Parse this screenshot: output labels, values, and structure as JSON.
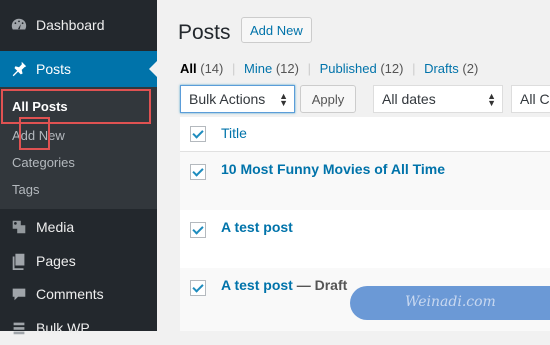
{
  "sidebar": {
    "items": [
      {
        "label": "Dashboard",
        "icon": "dashboard-icon"
      },
      {
        "label": "Posts",
        "icon": "pin-icon"
      },
      {
        "label": "Media",
        "icon": "media-icon"
      },
      {
        "label": "Pages",
        "icon": "pages-icon"
      },
      {
        "label": "Comments",
        "icon": "comments-icon"
      },
      {
        "label": "Bulk WP",
        "icon": "bulk-icon"
      }
    ],
    "submenu": [
      "All Posts",
      "Add New",
      "Categories",
      "Tags"
    ]
  },
  "page": {
    "title": "Posts",
    "add_new": "Add New"
  },
  "filters": {
    "all": "All",
    "all_count": "(14)",
    "mine": "Mine",
    "mine_count": "(12)",
    "published": "Published",
    "published_count": "(12)",
    "drafts": "Drafts",
    "drafts_count": "(2)",
    "separator": "|"
  },
  "actions": {
    "bulk_selected": "Bulk Actions",
    "apply": "Apply",
    "dates_selected": "All dates",
    "cats_selected": "All Ca"
  },
  "table": {
    "header_title": "Title",
    "rows": [
      {
        "title": "10 Most Funny Movies of All Time",
        "state": ""
      },
      {
        "title": "A test post",
        "state": ""
      },
      {
        "title": "A test post",
        "state": " — Draft"
      }
    ]
  },
  "watermark": "Weinadi.com",
  "colors": {
    "sidebar": "#23282d",
    "accent": "#0073aa",
    "highlight": "#e05252"
  }
}
